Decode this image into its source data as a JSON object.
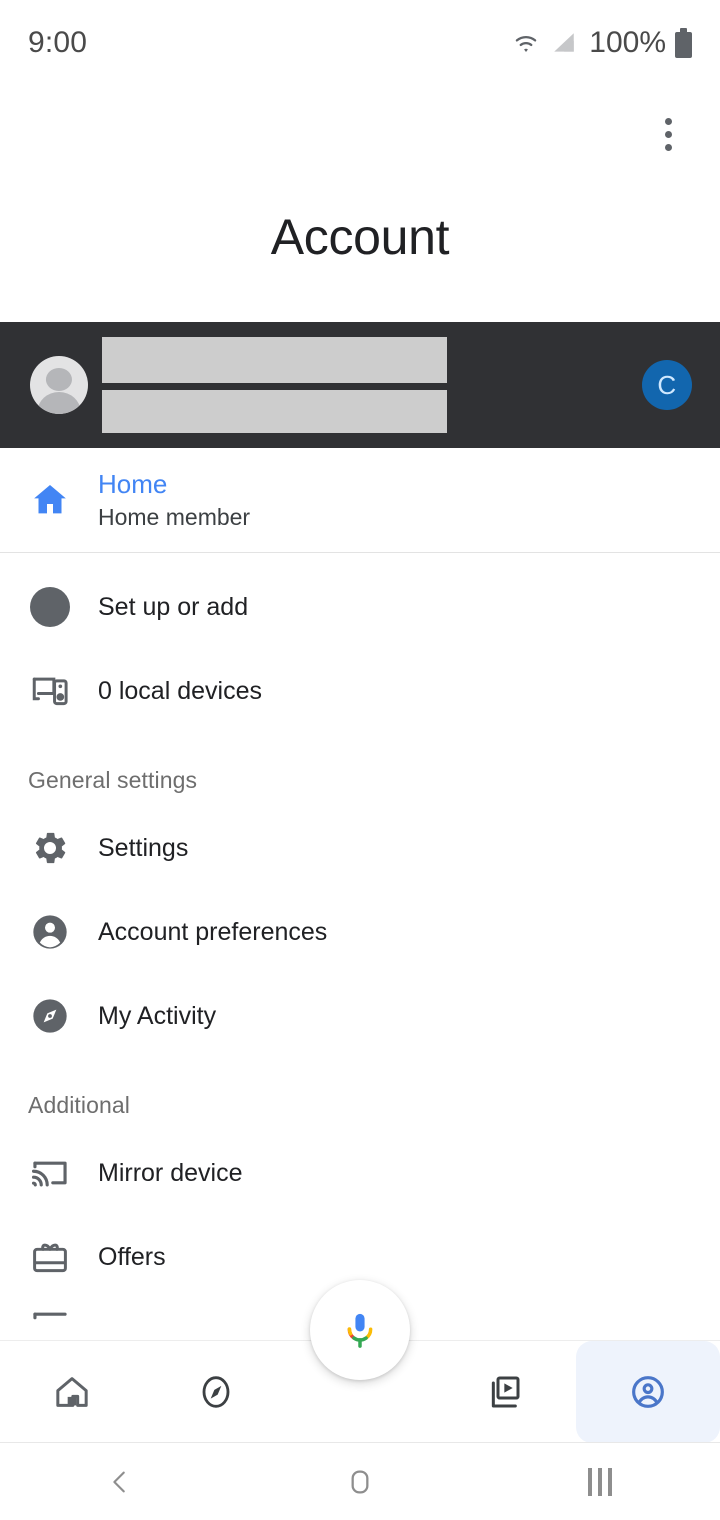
{
  "status_bar": {
    "time": "9:00",
    "battery_percent": "100%",
    "icons": [
      "wifi-icon",
      "cellular-signal-icon",
      "battery-icon"
    ]
  },
  "header": {
    "title": "Account",
    "overflow_menu": "more-options"
  },
  "account_banner": {
    "avatar": "default-account-avatar",
    "name_redacted": "",
    "email_redacted": "",
    "initial_badge": "C",
    "initial_badge_color": "#1266ae",
    "background_color": "#303134"
  },
  "home_row": {
    "label": "Home",
    "sublabel": "Home member",
    "accent_color": "#4285f4"
  },
  "quick_items": [
    {
      "label": "Set up or add",
      "icon": "add-circle-icon"
    },
    {
      "label": "0 local devices",
      "icon": "local-devices-icon"
    }
  ],
  "sections": [
    {
      "heading": "General settings",
      "items": [
        {
          "label": "Settings",
          "icon": "gear-icon"
        },
        {
          "label": "Account preferences",
          "icon": "person-circle-icon"
        },
        {
          "label": "My Activity",
          "icon": "compass-circle-icon"
        }
      ]
    },
    {
      "heading": "Additional",
      "items": [
        {
          "label": "Mirror device",
          "icon": "cast-icon"
        },
        {
          "label": "Offers",
          "icon": "gift-card-icon"
        }
      ]
    }
  ],
  "assistant_fab": {
    "icon": "google-assistant-mic-icon"
  },
  "bottom_nav": {
    "items": [
      {
        "name": "home",
        "icon": "home-outline-icon",
        "active": false
      },
      {
        "name": "explore",
        "icon": "compass-outline-icon",
        "active": false
      },
      {
        "name": "media",
        "icon": "media-library-icon",
        "active": false
      },
      {
        "name": "account",
        "icon": "account-circle-icon",
        "active": true
      }
    ],
    "active_color": "#4a76c9",
    "active_pill_color": "#eef3fc"
  },
  "system_nav": {
    "back": "back-icon",
    "home": "home-square-icon",
    "recents": "recents-icon"
  }
}
